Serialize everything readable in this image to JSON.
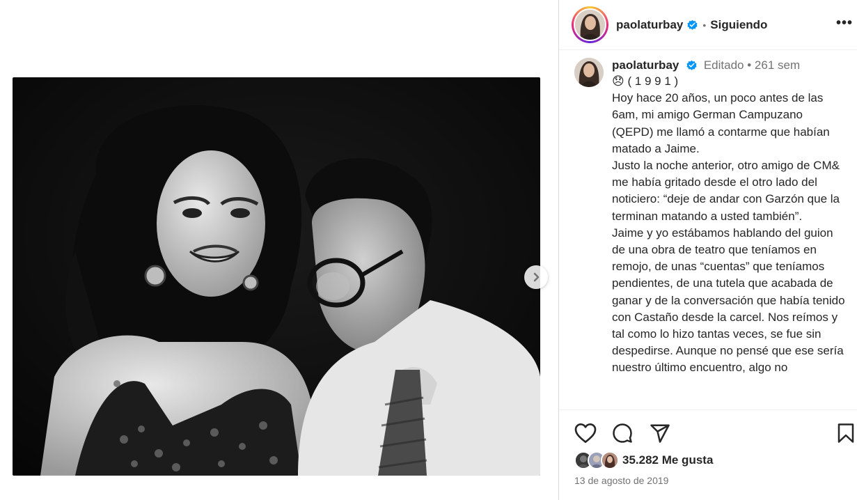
{
  "header": {
    "username": "paolaturbay",
    "separator": "•",
    "follow_label": "Siguiendo",
    "more_label": "•••"
  },
  "caption": {
    "username": "paolaturbay",
    "edited_label": "Editado",
    "separator": "•",
    "time": "261 sem",
    "year_line": "😞 ( 1 9 9 1 )",
    "text": "Hoy hace 20 años, un poco antes de las 6am, mi amigo German Campuzano (QEPD) me llamó a contarme que habían matado a Jaime.\nJusto la noche anterior, otro amigo de CM& me había gritado desde el otro lado del noticiero: “deje de andar con Garzón que la terminan matando a usted también”.\nJaime y yo estábamos hablando del guion de una obra de teatro que teníamos en remojo, de unas “cuentas” que teníamos pendientes, de una tutela que acabada de ganar y de la conversación que había tenido con Castaño desde la carcel. Nos reímos y tal como lo hizo tantas veces, se fue sin despedirse. Aunque no pensé que ese sería nuestro último encuentro, algo no"
  },
  "actions": {
    "like_icon": "heart-icon",
    "comment_icon": "comment-bubble-icon",
    "share_icon": "paper-plane-icon",
    "save_icon": "bookmark-icon"
  },
  "likes": {
    "count_text": "35.282 Me gusta"
  },
  "date": "13 de agosto de 2019",
  "colors": {
    "verified": "#0095f6",
    "text": "#262626",
    "secondary": "#737373",
    "border": "#dbdbdb"
  },
  "media": {
    "next_icon": "chevron-right-icon"
  }
}
